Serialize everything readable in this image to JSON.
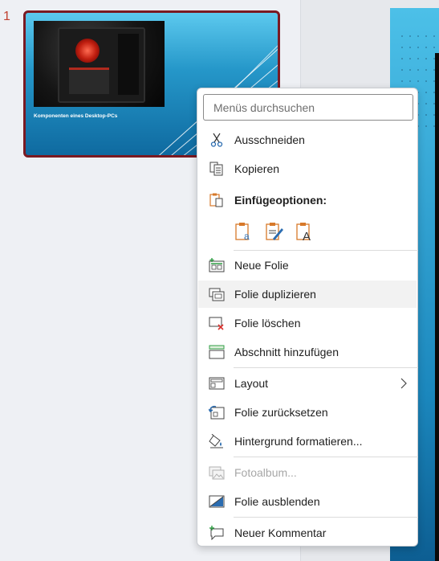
{
  "slide_panel": {
    "slide_number": "1",
    "thumbnail_title": "Komponenten eines Desktop-PCs"
  },
  "context_menu": {
    "search_placeholder": "Menüs durchsuchen",
    "items": [
      {
        "label": "Ausschneiden",
        "icon": "scissors-icon"
      },
      {
        "label": "Kopieren",
        "icon": "copy-icon"
      },
      {
        "label": "Einfügeoptionen:",
        "icon": "clipboard-icon"
      },
      {
        "label": "Neue Folie",
        "icon": "new-slide-icon"
      },
      {
        "label": "Folie duplizieren",
        "icon": "duplicate-slide-icon"
      },
      {
        "label": "Folie löschen",
        "icon": "delete-slide-icon"
      },
      {
        "label": "Abschnitt hinzufügen",
        "icon": "add-section-icon"
      },
      {
        "label": "Layout",
        "icon": "layout-icon"
      },
      {
        "label": "Folie zurücksetzen",
        "icon": "reset-slide-icon"
      },
      {
        "label": "Hintergrund formatieren...",
        "icon": "format-background-icon"
      },
      {
        "label": "Fotoalbum...",
        "icon": "photo-album-icon"
      },
      {
        "label": "Folie ausblenden",
        "icon": "hide-slide-icon"
      },
      {
        "label": "Neuer Kommentar",
        "icon": "new-comment-icon"
      }
    ],
    "paste_options": [
      {
        "icon": "paste-use-destination-theme-icon"
      },
      {
        "icon": "paste-keep-source-formatting-icon"
      },
      {
        "icon": "paste-keep-text-only-icon"
      }
    ]
  },
  "colors": {
    "accent": "#c0402f",
    "selection_border": "#7a1a22",
    "icon_orange": "#d7792a",
    "icon_blue": "#2b6cb0"
  }
}
